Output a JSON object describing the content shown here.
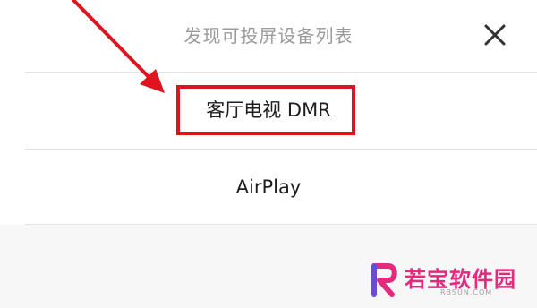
{
  "dialog": {
    "title": "发现可投屏设备列表",
    "close_icon": "close-icon"
  },
  "devices": [
    {
      "label": "客厅电视 DMR",
      "highlighted": true
    },
    {
      "label": "AirPlay",
      "highlighted": false
    }
  ],
  "annotation": {
    "color": "#e0141f"
  },
  "watermark": {
    "text": "若宝软件园",
    "sub": "RBSUN.COM",
    "color": "#e42a7c"
  }
}
